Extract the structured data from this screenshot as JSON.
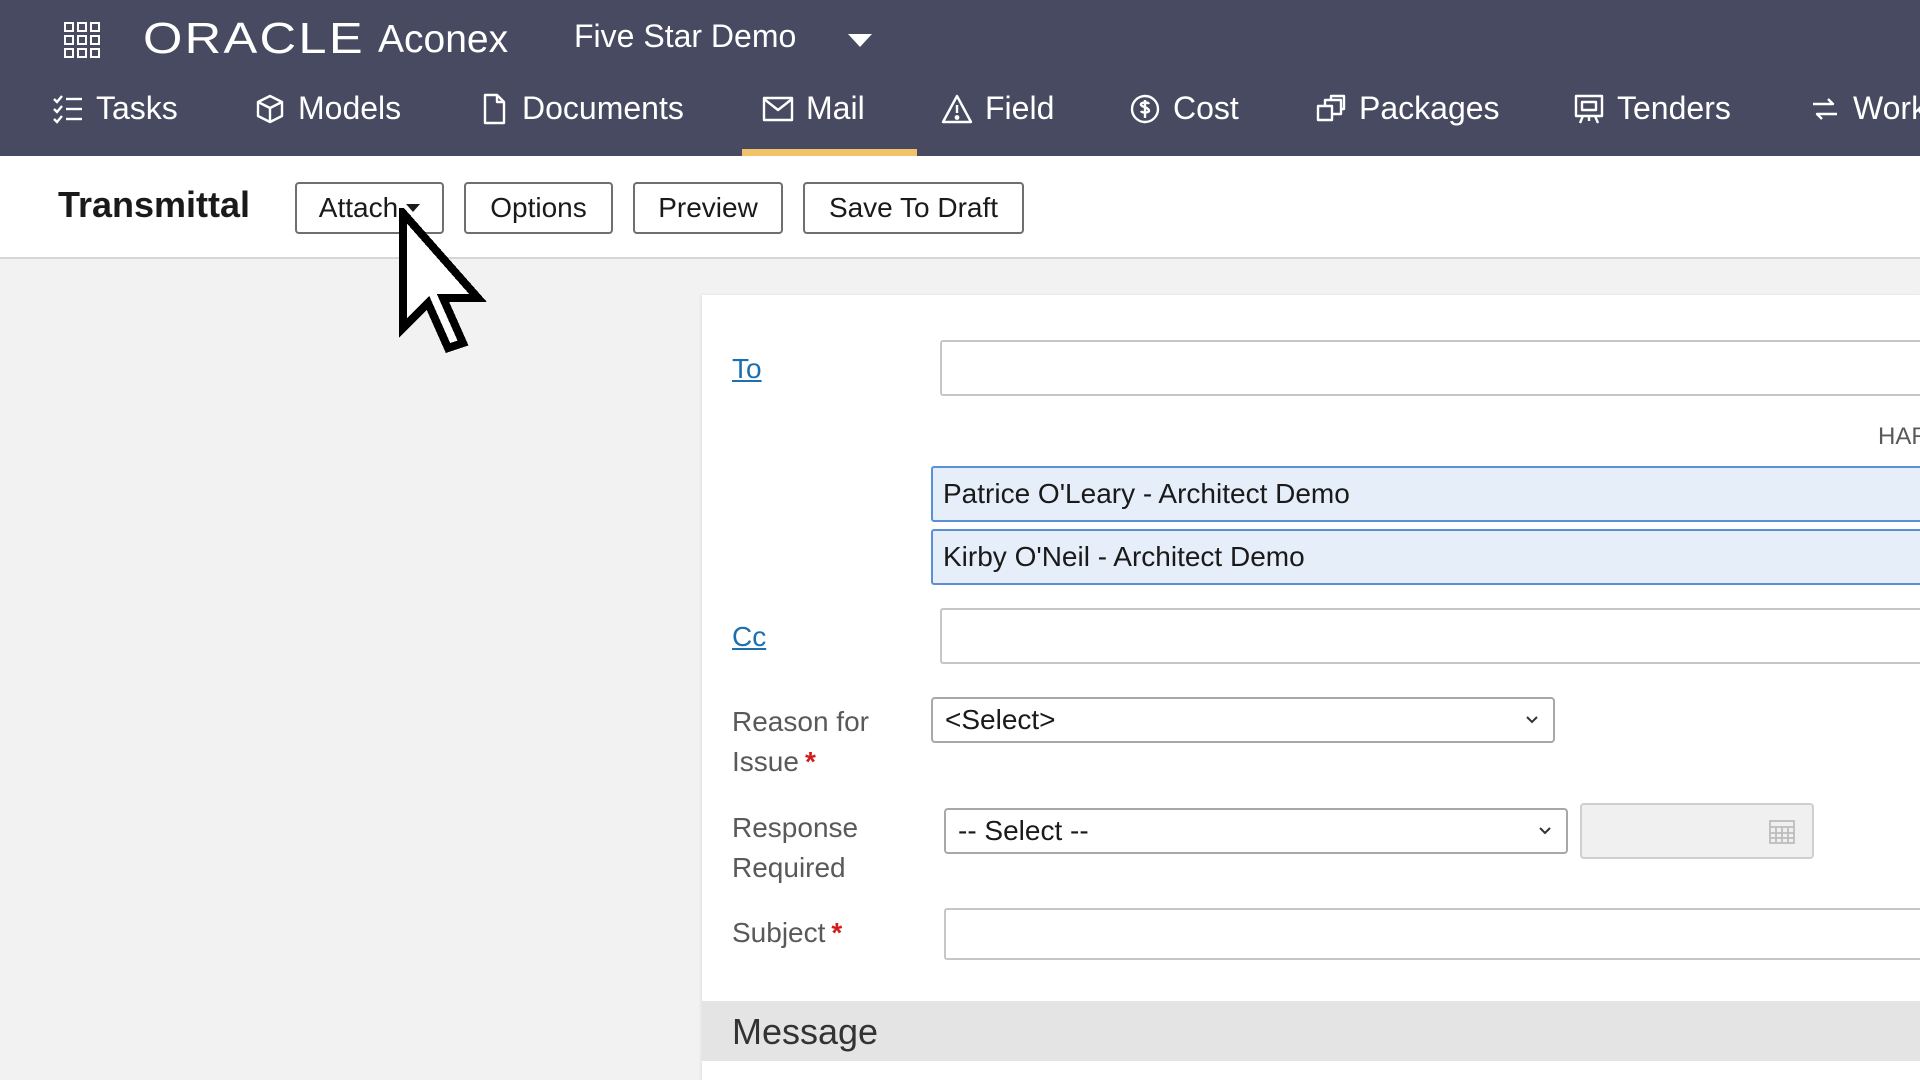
{
  "header": {
    "brand_oracle": "ORACLE",
    "brand_aconex": "Aconex",
    "project_name": "Five Star Demo"
  },
  "nav": {
    "items": [
      {
        "label": "Tasks",
        "icon": "tasks-icon"
      },
      {
        "label": "Models",
        "icon": "cube-icon"
      },
      {
        "label": "Documents",
        "icon": "document-icon"
      },
      {
        "label": "Mail",
        "icon": "mail-icon",
        "active": true
      },
      {
        "label": "Field",
        "icon": "warning-icon"
      },
      {
        "label": "Cost",
        "icon": "dollar-icon"
      },
      {
        "label": "Packages",
        "icon": "packages-icon"
      },
      {
        "label": "Tenders",
        "icon": "tenders-icon"
      },
      {
        "label": "Work",
        "icon": "workflow-icon"
      }
    ],
    "active_color": "#f0c36b"
  },
  "toolbar": {
    "title": "Transmittal",
    "attach_label": "Attach",
    "options_label": "Options",
    "preview_label": "Preview",
    "save_draft_label": "Save To Draft"
  },
  "form": {
    "to_label": "To",
    "to_value": "",
    "hint_fragment": "HAR",
    "recipients": [
      "Patrice O'Leary - Architect Demo",
      "Kirby O'Neil - Architect Demo"
    ],
    "cc_label": "Cc",
    "cc_value": "",
    "reason_label_line1": "Reason for",
    "reason_label_line2": "Issue",
    "reason_value": "<Select>",
    "response_label_line1": "Response",
    "response_label_line2": "Required",
    "response_value": "-- Select --",
    "date_value": "",
    "subject_label": "Subject",
    "subject_value": "",
    "required_marker": "*",
    "message_heading": "Message"
  },
  "colors": {
    "topbar": "#474a60",
    "link": "#1d6fb0",
    "required": "#d11d1d",
    "recipient_bg": "#e6eef9",
    "recipient_border": "#5b8fd6"
  }
}
